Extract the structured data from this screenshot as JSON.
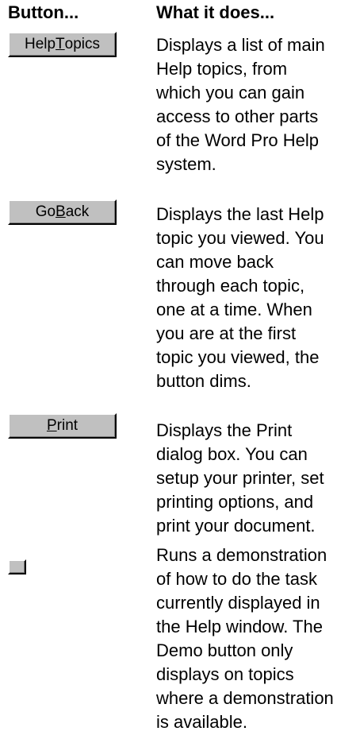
{
  "headers": {
    "button_col": "Button...",
    "desc_col": "What it does..."
  },
  "rows": [
    {
      "button": {
        "pre": "Help ",
        "accel": "T",
        "post": "opics"
      },
      "description_lines": [
        "Displays a list of main",
        "Help topics, from",
        "which you can gain",
        "access to other parts",
        "of the Word Pro Help",
        "system."
      ]
    },
    {
      "button": {
        "pre": "Go ",
        "accel": "B",
        "post": "ack"
      },
      "description_lines": [
        "Displays the last Help",
        "topic you viewed. You",
        "can move back",
        "through each topic,",
        "one at a time. When",
        "you are at the first",
        "topic you viewed, the",
        "button dims."
      ]
    },
    {
      "button": {
        "pre": "",
        "accel": "P",
        "post": "rint"
      },
      "description_lines": [
        "Displays the Print",
        "dialog box. You can",
        "setup your printer, set",
        "printing options, and",
        "print your document."
      ]
    },
    {
      "button": {
        "pre": "",
        "accel": "",
        "post": ""
      },
      "description_lines": [
        "Runs a demonstration",
        "of how to do the task",
        "currently displayed in",
        "the Help window. The",
        "Demo button only",
        "displays on topics",
        "where a demonstration",
        "is available."
      ]
    }
  ]
}
